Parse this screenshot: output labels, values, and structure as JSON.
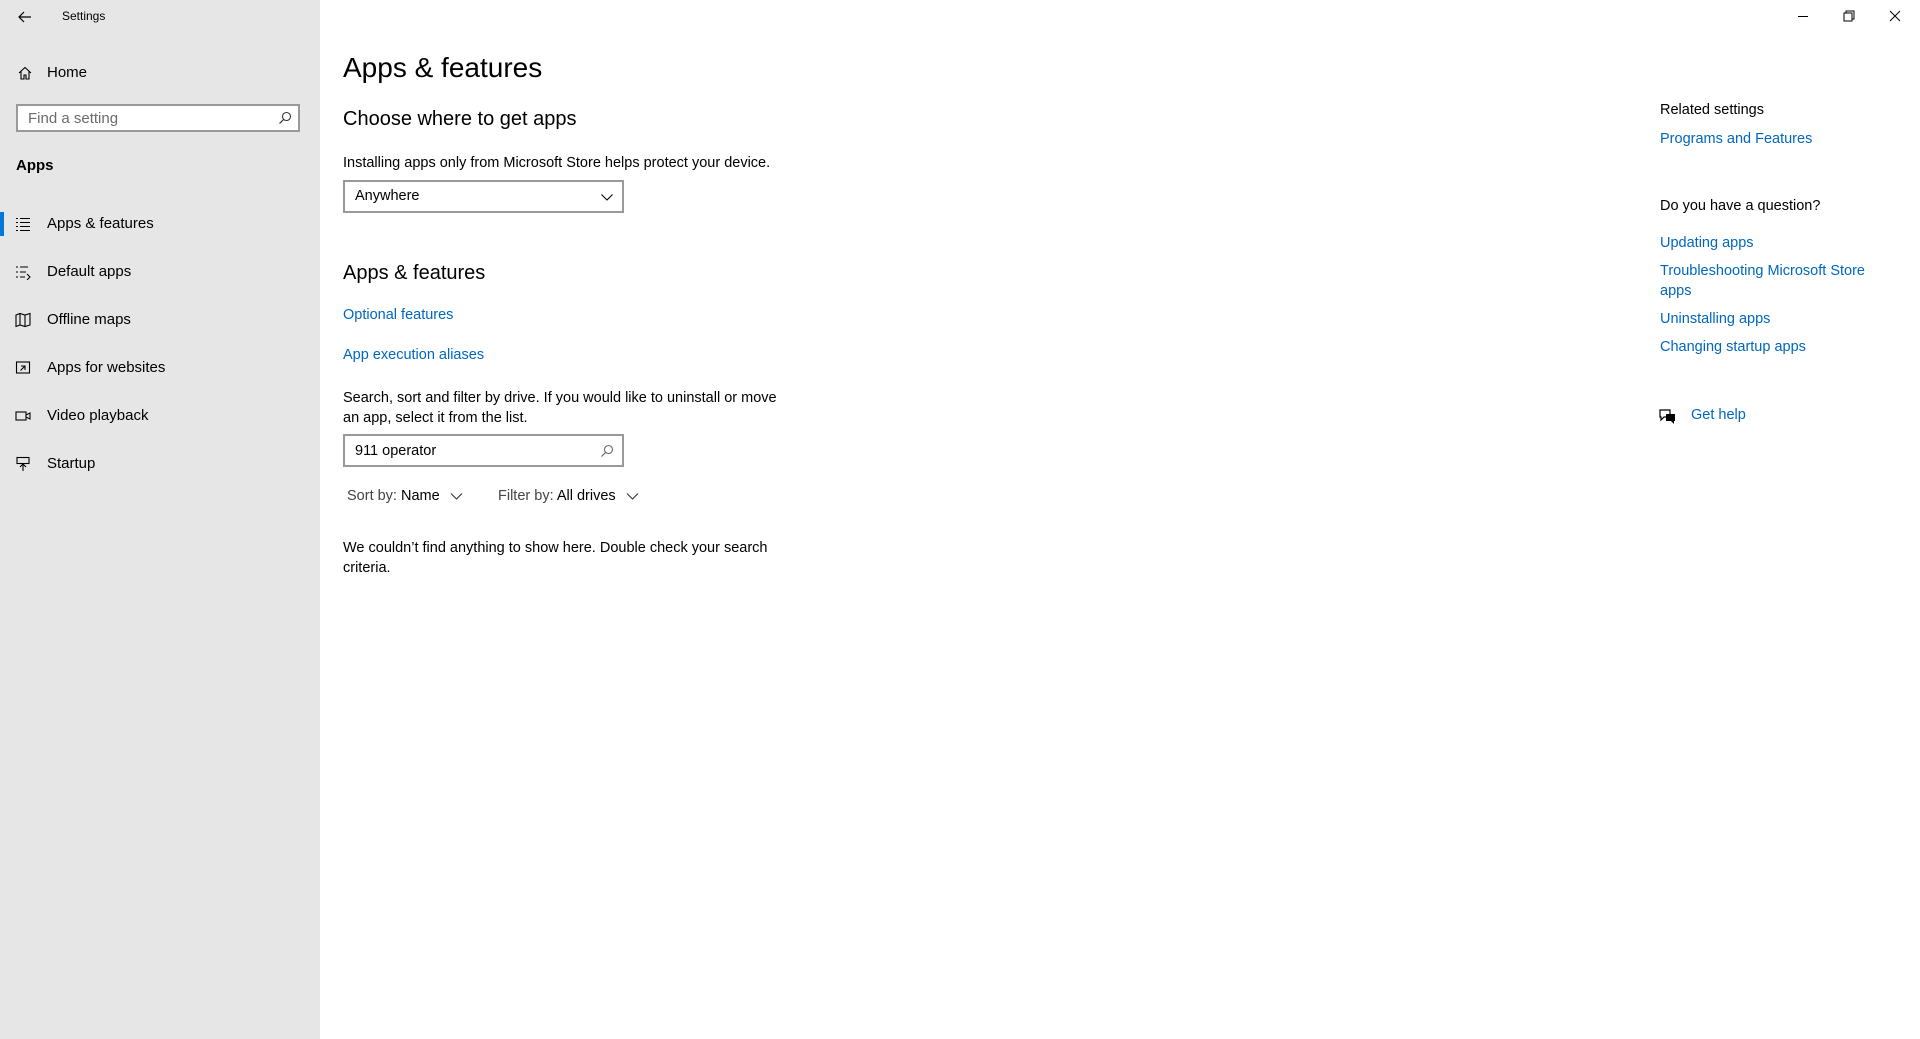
{
  "window": {
    "title": "Settings",
    "controls": {
      "minimize": "minimize-icon",
      "restore": "restore-icon",
      "close": "close-icon"
    }
  },
  "sidebar": {
    "home_label": "Home",
    "search_placeholder": "Find a setting",
    "section_label": "Apps",
    "items": [
      {
        "label": "Apps & features",
        "icon": "apps-features-icon",
        "active": true
      },
      {
        "label": "Default apps",
        "icon": "default-apps-icon",
        "active": false
      },
      {
        "label": "Offline maps",
        "icon": "offline-maps-icon",
        "active": false
      },
      {
        "label": "Apps for websites",
        "icon": "apps-for-websites-icon",
        "active": false
      },
      {
        "label": "Video playback",
        "icon": "video-playback-icon",
        "active": false
      },
      {
        "label": "Startup",
        "icon": "startup-icon",
        "active": false
      }
    ]
  },
  "main": {
    "title": "Apps & features",
    "choose_heading": "Choose where to get apps",
    "choose_description": "Installing apps only from Microsoft Store helps protect your device.",
    "source_dropdown_value": "Anywhere",
    "apps_heading": "Apps & features",
    "optional_features_link": "Optional features",
    "app_execution_aliases_link": "App execution aliases",
    "search_description": "Search, sort and filter by drive. If you would like to uninstall or move an app, select it from the list.",
    "search_value": "911 operator",
    "sort_label": "Sort by:",
    "sort_value": "Name",
    "filter_label": "Filter by:",
    "filter_value": "All drives",
    "empty_message": "We couldn’t find anything to show here. Double check your search criteria."
  },
  "related": {
    "heading": "Related settings",
    "programs_link": "Programs and Features",
    "question_heading": "Do you have a question?",
    "question_links": [
      "Updating apps",
      "Troubleshooting Microsoft Store apps",
      "Uninstalling apps",
      "Changing startup apps"
    ],
    "get_help_label": "Get help"
  },
  "colors": {
    "accent": "#0078d7",
    "link": "#0067c0",
    "sidebar_bg": "#e6e6e6"
  }
}
